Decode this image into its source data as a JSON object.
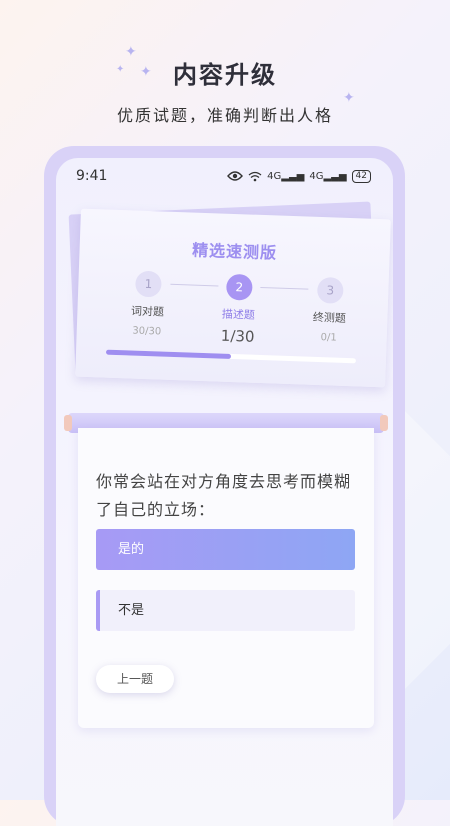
{
  "headline": {
    "title": "内容升级",
    "subtitle": "优质试题，准确判断出人格"
  },
  "status": {
    "time": "9:41",
    "signal1": "4G",
    "signal2": "4G",
    "battery": "42"
  },
  "card": {
    "title": "精选速测版",
    "steps": [
      {
        "number": "1",
        "name": "词对题",
        "count": "30/30",
        "state": "inactive"
      },
      {
        "number": "2",
        "name": "描述题",
        "count": "1/30",
        "state": "active"
      },
      {
        "number": "3",
        "name": "终测题",
        "count": "0/1",
        "state": "inactive"
      }
    ],
    "progress": 0.5
  },
  "question": {
    "text": "你常会站在对方角度去思考而模糊了自己的立场：",
    "options": [
      "是的",
      "不是"
    ],
    "selected_index": 0,
    "prev_label": "上一题"
  },
  "colors": {
    "accent": "#a895f3",
    "option_gradient_start": "#a79af5",
    "option_gradient_end": "#8ea6f4"
  },
  "icons": [
    "sparkle-icon",
    "eye-icon",
    "wifi-icon",
    "signal-icon",
    "battery-icon"
  ]
}
